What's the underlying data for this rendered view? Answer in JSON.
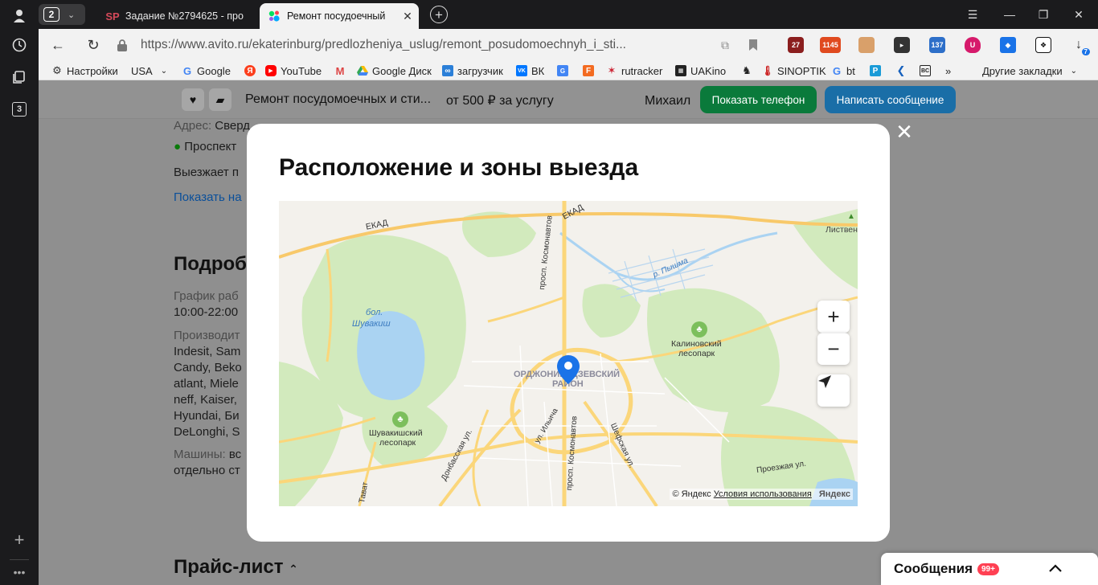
{
  "browser": {
    "rail": {
      "tab_count_badge": "3"
    },
    "tabs": {
      "group_count": "2",
      "inactive": {
        "favicon": "SP",
        "title": "Задание №2794625 - про"
      },
      "active": {
        "title": "Ремонт посудоечный"
      }
    },
    "address": {
      "url": "https://www.avito.ru/ekaterinburg/predlozheniya_uslug/remont_posudomoechnyh_i_sti..."
    },
    "extensions": {
      "badge_27": "27",
      "badge_1145": "1145",
      "badge_137": "137",
      "download_badge": "7"
    },
    "bookmarks": [
      {
        "label": "Настройки",
        "icon": "gear-icon"
      },
      {
        "label": "USA"
      },
      {
        "label": "Google"
      },
      {
        "label": ""
      },
      {
        "label": "YouTube"
      },
      {
        "label": ""
      },
      {
        "label": "Google Диск"
      },
      {
        "label": "загрузчик"
      },
      {
        "label": "ВК"
      },
      {
        "label": ""
      },
      {
        "label": ""
      },
      {
        "label": "rutracker"
      },
      {
        "label": "UAKino"
      },
      {
        "label": ""
      },
      {
        "label": "SINOPTIK"
      },
      {
        "label": "bt"
      },
      {
        "label": ""
      },
      {
        "label": ""
      },
      {
        "label": ""
      },
      {
        "label": "»"
      },
      {
        "label": "Другие закладки"
      }
    ]
  },
  "sticky": {
    "listing_title": "Ремонт посудомоечных и сти...",
    "price": "от 500 ₽ за услугу",
    "seller_name": "Михаил",
    "show_phone": "Показать телефон",
    "write_message": "Написать сообщение"
  },
  "page": {
    "address_label": "Адрес:",
    "address_value": "Сверд",
    "metro": "Проспект",
    "departure": "Выезжает п",
    "show_more": "Показать на",
    "details_heading": "Подроб",
    "schedule_label": "График раб",
    "schedule_value": "10:00-22:00",
    "manufacturers_label": "Производит",
    "manufacturers_lines": [
      "Indesit, Sam",
      "Candy, Beko",
      "atlant, Miele",
      "neff, Kaiser,",
      "Hyundai, Би",
      "DeLonghi, S"
    ],
    "machines_label": "Машины:",
    "machines_value": "вс",
    "machines_line2": "отдельно ст",
    "price_heading": "Прайс-лист"
  },
  "modal": {
    "title": "Расположение и зоны выезда",
    "map": {
      "labels": {
        "ekad_left": "ЕКАД",
        "ekad_top": "ЕКАД",
        "kosmonavtov_north": "просп. Космонавтов",
        "pyshma": "р. Пышма",
        "listvennoe": "Листвен",
        "lake_1": "бол.",
        "lake_2": "Шувакиш",
        "kalinovsky_1": "Калиновский",
        "kalinovsky_2": "лесопарк",
        "district_1": "ОРДЖОНИКИДЗЕВСКИЙ",
        "district_2": "РАЙОН",
        "ilyicha": "ул. Ильича",
        "kosmonavtov_south": "просп. Космонавтов",
        "shefskaya": "Шефская ул.",
        "shuvakish_1": "Шувакишский",
        "shuvakish_2": "лесопарк",
        "donbasskaya": "Донбасская ул.",
        "proezzhaya": "Проезжая ул.",
        "tavatui": "Тават"
      },
      "zoom_in": "+",
      "zoom_out": "−",
      "copyright": "© Яндекс",
      "terms": "Условия использования",
      "brand": "Яндекс"
    }
  },
  "messages": {
    "label": "Сообщения",
    "badge": "99+"
  },
  "colors": {
    "green_button": "#00a046",
    "blue_button": "#0099f7",
    "map_road": "#fbd67a",
    "map_forest": "#cfe8b8",
    "map_water": "#aad3f2",
    "pin": "#1a73e8"
  }
}
